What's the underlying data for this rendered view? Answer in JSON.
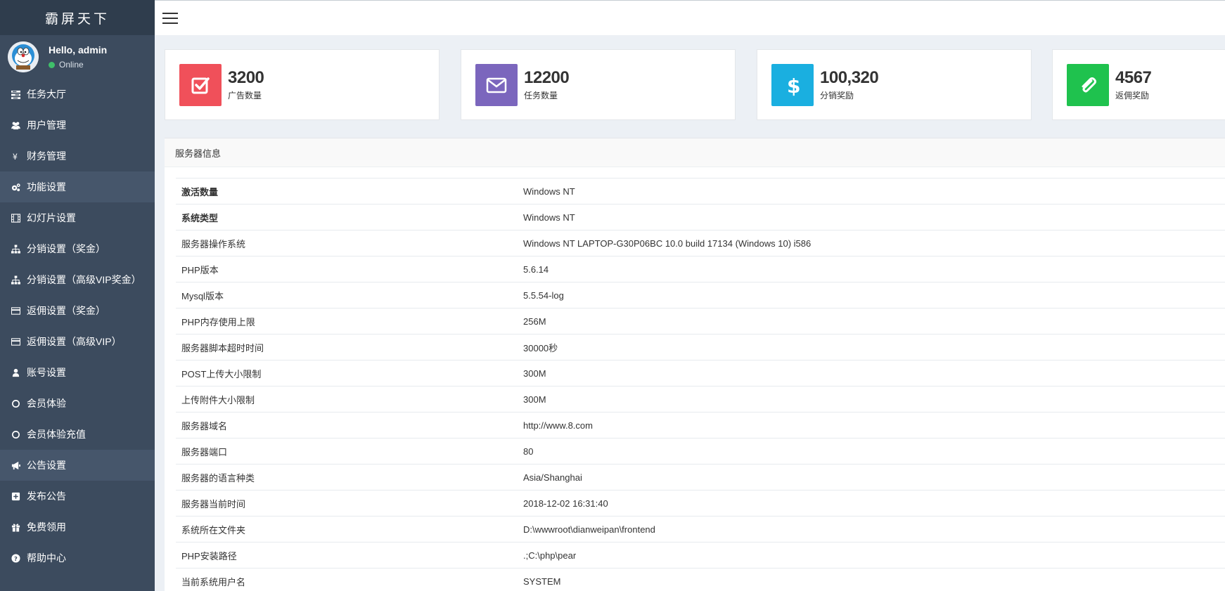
{
  "brand": {
    "title": "霸屏天下"
  },
  "user": {
    "greeting": "Hello, admin",
    "status": "Online"
  },
  "sidebar": {
    "items": [
      {
        "label": "任务大厅",
        "icon": "tasks-icon",
        "active": false
      },
      {
        "label": "用户管理",
        "icon": "users-icon",
        "active": false
      },
      {
        "label": "财务管理",
        "icon": "yen-icon",
        "active": false
      },
      {
        "label": "功能设置",
        "icon": "cogs-icon",
        "active": true
      },
      {
        "label": "幻灯片设置",
        "icon": "film-icon",
        "active": false
      },
      {
        "label": "分销设置（奖金）",
        "icon": "sitemap-icon",
        "active": false
      },
      {
        "label": "分销设置（高级VIP奖金）",
        "icon": "sitemap-icon",
        "active": false
      },
      {
        "label": "返佣设置（奖金）",
        "icon": "credit-card-icon",
        "active": false
      },
      {
        "label": "返佣设置（高级VIP）",
        "icon": "credit-card-icon",
        "active": false
      },
      {
        "label": "账号设置",
        "icon": "user-icon",
        "active": false
      },
      {
        "label": "会员体验",
        "icon": "circle-icon",
        "active": false
      },
      {
        "label": "会员体验充值",
        "icon": "circle-icon",
        "active": false
      },
      {
        "label": "公告设置",
        "icon": "bullhorn-icon",
        "active": true
      },
      {
        "label": "发布公告",
        "icon": "plus-square-icon",
        "active": false
      },
      {
        "label": "免费领用",
        "icon": "gift-icon",
        "active": false
      },
      {
        "label": "帮助中心",
        "icon": "question-circle-icon",
        "active": false
      }
    ]
  },
  "cards": [
    {
      "value": "3200",
      "label": "广告数量",
      "icon": "check-square-icon",
      "color": "#f0505a"
    },
    {
      "value": "12200",
      "label": "任务数量",
      "icon": "envelope-icon",
      "color": "#7b66bd"
    },
    {
      "value": "100,320",
      "label": "分销奖励",
      "icon": "dollar-icon",
      "color": "#1aafe0"
    },
    {
      "value": "4567",
      "label": "返佣奖励",
      "icon": "paperclip-icon",
      "color": "#1fc24e"
    }
  ],
  "server_info": {
    "title": "服务器信息",
    "rows": [
      {
        "key": "激活数量",
        "value": "Windows NT",
        "bold": true
      },
      {
        "key": "系统类型",
        "value": "Windows NT",
        "bold": true
      },
      {
        "key": "服务器操作系统",
        "value": "Windows NT LAPTOP-G30P06BC 10.0 build 17134 (Windows 10) i586",
        "bold": false
      },
      {
        "key": "PHP版本",
        "value": "5.6.14",
        "bold": false
      },
      {
        "key": "Mysql版本",
        "value": "5.5.54-log",
        "bold": false
      },
      {
        "key": "PHP内存使用上限",
        "value": "256M",
        "bold": false
      },
      {
        "key": "服务器脚本超时时间",
        "value": "30000秒",
        "bold": false
      },
      {
        "key": "POST上传大小限制",
        "value": "300M",
        "bold": false
      },
      {
        "key": "上传附件大小限制",
        "value": "300M",
        "bold": false
      },
      {
        "key": "服务器域名",
        "value": "http://www.8.com",
        "bold": false
      },
      {
        "key": "服务器端口",
        "value": "80",
        "bold": false
      },
      {
        "key": "服务器的语言种类",
        "value": "Asia/Shanghai",
        "bold": false
      },
      {
        "key": "服务器当前时间",
        "value": "2018-12-02 16:31:40",
        "bold": false
      },
      {
        "key": "系统所在文件夹",
        "value": "D:\\wwwroot\\dianweipan\\frontend",
        "bold": false
      },
      {
        "key": "PHP安装路径",
        "value": ".;C:\\php\\pear",
        "bold": false
      },
      {
        "key": "当前系统用户名",
        "value": "SYSTEM",
        "bold": false
      }
    ]
  }
}
